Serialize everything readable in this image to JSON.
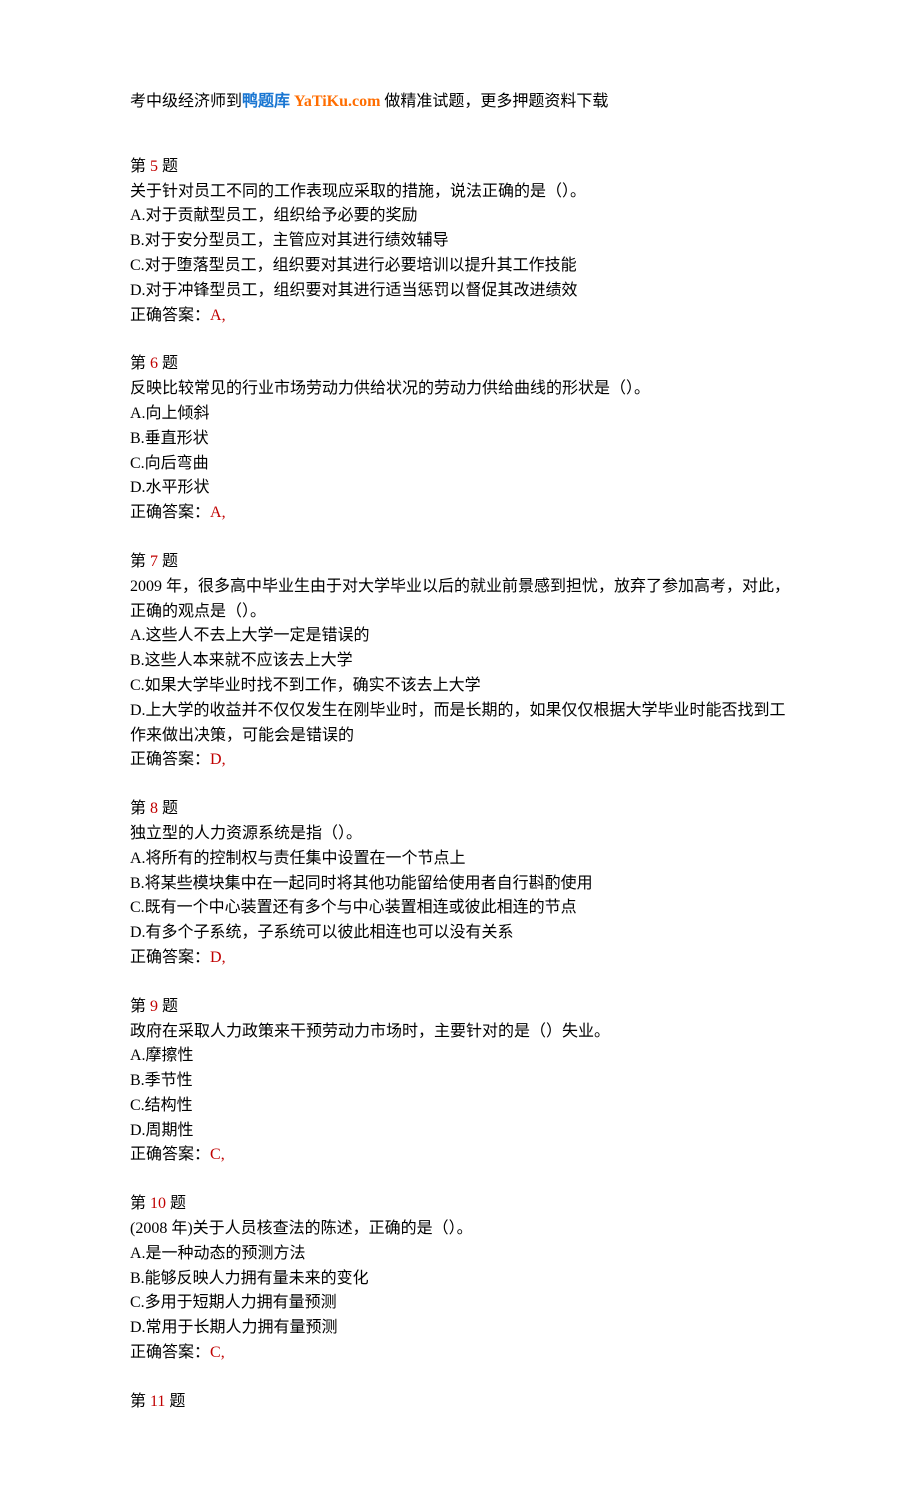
{
  "header": {
    "prefix": "考中级经济师到",
    "brand_blue": "鸭题库 ",
    "brand_red": "YaTiKu.com",
    "suffix": " 做精准试题，更多押题资料下载"
  },
  "labels": {
    "di": "第 ",
    "ti": " 题",
    "answer_prefix": "正确答案："
  },
  "questions": [
    {
      "num": "5",
      "stem": "关于针对员工不同的工作表现应采取的措施，说法正确的是（）。",
      "options": [
        "A.对于贡献型员工，组织给予必要的奖励",
        "B.对于安分型员工，主管应对其进行绩效辅导",
        "C.对于堕落型员工，组织要对其进行必要培训以提升其工作技能",
        "D.对于冲锋型员工，组织要对其进行适当惩罚以督促其改进绩效"
      ],
      "answer": "A,"
    },
    {
      "num": "6",
      "stem": "反映比较常见的行业市场劳动力供给状况的劳动力供给曲线的形状是（）。",
      "options": [
        "A.向上倾斜",
        "B.垂直形状",
        "C.向后弯曲",
        "D.水平形状"
      ],
      "answer": "A,"
    },
    {
      "num": "7",
      "stem": "2009 年，很多高中毕业生由于对大学毕业以后的就业前景感到担忧，放弃了参加高考，对此，正确的观点是（）。",
      "options": [
        "A.这些人不去上大学一定是错误的",
        "B.这些人本来就不应该去上大学",
        "C.如果大学毕业时找不到工作，确实不该去上大学",
        "D.上大学的收益并不仅仅发生在刚毕业时，而是长期的，如果仅仅根据大学毕业时能否找到工作来做出决策，可能会是错误的"
      ],
      "answer": "D,"
    },
    {
      "num": "8",
      "stem": "独立型的人力资源系统是指（）。",
      "options": [
        "A.将所有的控制权与责任集中设置在一个节点上",
        "B.将某些模块集中在一起同时将其他功能留给使用者自行斟酌使用",
        "C.既有一个中心装置还有多个与中心装置相连或彼此相连的节点",
        "D.有多个子系统，子系统可以彼此相连也可以没有关系"
      ],
      "answer": "D,"
    },
    {
      "num": "9",
      "stem": "政府在采取人力政策来干预劳动力市场时，主要针对的是（）失业。",
      "options": [
        "A.摩擦性",
        "B.季节性",
        "C.结构性",
        "D.周期性"
      ],
      "answer": "C,"
    },
    {
      "num": "10",
      "stem": "(2008 年)关于人员核查法的陈述，正确的是（）。",
      "options": [
        "A.是一种动态的预测方法",
        "B.能够反映人力拥有量未来的变化",
        "C.多用于短期人力拥有量预测",
        "D.常用于长期人力拥有量预测"
      ],
      "answer": "C,"
    },
    {
      "num": "11",
      "stem": "",
      "options": [],
      "answer": ""
    }
  ]
}
